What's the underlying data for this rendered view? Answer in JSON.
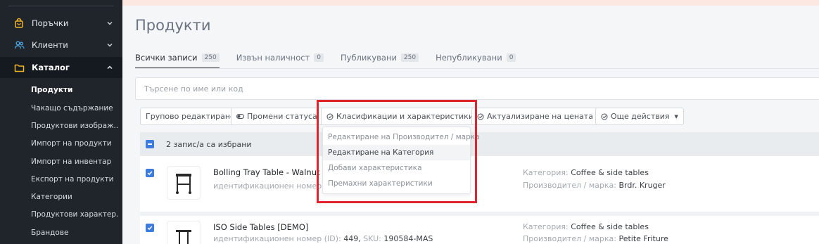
{
  "colors": {
    "sidebar_bg": "#1f252b",
    "accent": "#3c7be0",
    "highlight": "#e0242b",
    "menu_icon": "#f0b429",
    "clients_icon": "#4aa3df"
  },
  "sidebar": {
    "menu": [
      {
        "label": "Поръчки",
        "icon": "shopping-bag-icon",
        "expanded": false
      },
      {
        "label": "Клиенти",
        "icon": "users-icon",
        "expanded": false
      },
      {
        "label": "Каталог",
        "icon": "folder-icon",
        "expanded": true
      }
    ],
    "submenu": [
      "Продукти",
      "Чакащо съдържание",
      "Продуктови изображ...",
      "Импорт на продукти",
      "Импорт на инвентар",
      "Експорт на продукти",
      "Категории",
      "Продуктови характер...",
      "Брандове"
    ]
  },
  "page": {
    "title": "Продукти"
  },
  "tabs": [
    {
      "label": "Всички записи",
      "count": "250"
    },
    {
      "label": "Извън наличност",
      "count": "0"
    },
    {
      "label": "Публикувани",
      "count": "250"
    },
    {
      "label": "Непубликувани",
      "count": "0"
    }
  ],
  "search": {
    "placeholder": "Търсене по име или код"
  },
  "toolbar": {
    "bulk_edit": "Групово редактиране",
    "change_status": "Промени статуса",
    "classifications": "Класификации и характеристики",
    "update_price": "Актуализиране на цената",
    "more_actions": "Още действия"
  },
  "dropdown": {
    "items": [
      "Редактиране на Производител / марка",
      "Редактиране на Категория",
      "Добави характеристика",
      "Премахни характеристики"
    ]
  },
  "selection": {
    "text": "2 запис/а са избрани"
  },
  "products": [
    {
      "name": "Bolling Tray Table - Walnut [DEMO]",
      "id_label": "идентификационен номер (ID):",
      "id": "",
      "sku_label": "",
      "sku": "",
      "category_label": "Категория:",
      "category": "Coffee & side tables",
      "brand_label": "Производител / марка:",
      "brand": "Brdr. Kruger"
    },
    {
      "name": "ISO Side Tables [DEMO]",
      "id_label": "идентификационен номер (ID):",
      "id": "449,",
      "sku_label": "SKU:",
      "sku": "190584-MAS",
      "category_label": "Категория:",
      "category": "Coffee & side tables",
      "brand_label": "Производител / марка:",
      "brand": "Petite Friture"
    }
  ]
}
